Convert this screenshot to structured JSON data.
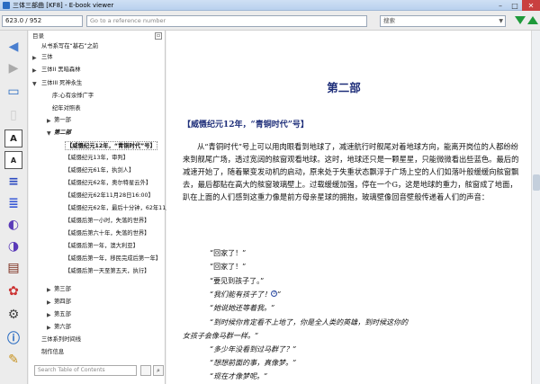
{
  "window": {
    "title": "三体三部曲 [KF8] - E-book viewer"
  },
  "toolbar": {
    "page": "623.0 / 952",
    "reference_placeholder": "Go to a reference number",
    "search_placeholder": "搜索"
  },
  "toc": {
    "header": "目录",
    "search_placeholder": "Search Table of Contents",
    "items": [
      "从书系写在“基石”之前",
      "三体",
      "三体II 黑暗森林",
      "三体III 死神永生",
      "序:心有余悸广字",
      "纪年对照表",
      "第一部",
      "第二部",
      "【威慑纪元12年，“青铜时代”号】",
      "【威慑纪元13年，审判】",
      "【威慑纪元61年，执剑人】",
      "【威慑纪元62年，奥尔特星云外】",
      "【威慑纪元62年11月28日16:00】",
      "【威慑纪元62年，最后十分钟，62年11月】",
      "【威慑后第一小时，失落的世界】",
      "【威慑后第六十年，失落的世界】",
      "【威慑后第一年，澳大利亚】",
      "【威慑后第一年，移民完成后第一年】",
      "【威慑后第一天至第五天，执行】",
      "第三部",
      "第四部",
      "第五部",
      "第六部",
      "三体系列时间线",
      "制作信息"
    ]
  },
  "content": {
    "part_title": "第二部",
    "chapter_title": "【威慑纪元12年，“青铜时代”号】",
    "paragraph": "从“青铜时代”号上可以用肉眼看到地球了，减速航行时舰尾对着地球方向，能离开岗位的人都纷纷来到舰尾广场，透过宽阔的舷窗观看地球。这时，地球还只是一颗星星，只能微微看出些蓝色。最后的减速开始了，随着聚变发动机的启动，原来处于失重状态飘浮于广场上空的人们如落叶般缓缓向舷窗飘去，最后都贴在高大的舷窗玻璃壁上。过载缓缓加强，停在一个G，这是地球的重力，舷窗成了地面，趴在上面的人们感到这重力像是前方母亲星球的拥抱，玻璃壁像回音壁般传递着人们的声音：",
    "lines": [
      "“回家了！”",
      "“回家了！”",
      "“要见到孩子了。”",
      "“我们能有孩子了！",
      "“她说她还等着我。”",
      "“到时候你肯定看不上地了，你是全人类的英雄，到时候这你的",
      "女孩子会像马群一样。”",
      "“多少年没看到过马群了？”",
      "“想想前面的事，真像梦。”",
      "“现在才像梦呢。”"
    ],
    "footnote": "①"
  },
  "colors": {
    "accent": "#1f2f7a",
    "nav_arrow": "#1f9a3a"
  }
}
